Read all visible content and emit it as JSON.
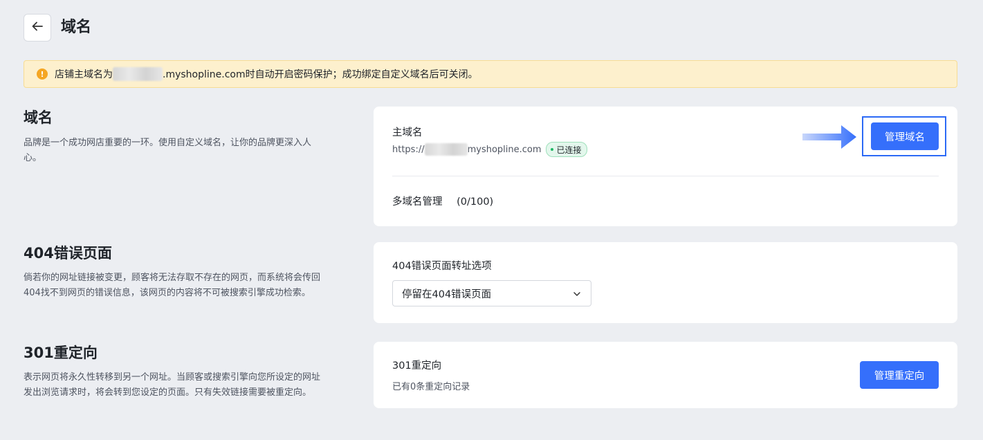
{
  "header": {
    "title": "域名"
  },
  "notice": {
    "prefix": "店铺主域名为",
    "suffix": ".myshopline.com时自动开启密码保护；成功绑定自定义域名后可关闭。"
  },
  "sections": {
    "domain": {
      "title": "域名",
      "desc": "品牌是一个成功网店重要的一环。使用自定义域名，让你的品牌更深入人心。",
      "primary_label": "主域名",
      "url_prefix": "https://",
      "url_suffix": "myshopline.com",
      "status": "已连接",
      "manage_button": "管理域名",
      "multi_label": "多域名管理",
      "multi_count": "(0/100)"
    },
    "error404": {
      "title": "404错误页面",
      "desc": "倘若你的网址链接被变更，顾客将无法存取不存在的网页，而系统将会传回404找不到网页的错误信息，该网页的内容将不可被搜索引擎成功检索。",
      "select_label": "404错误页面转址选项",
      "select_value": "停留在404错误页面"
    },
    "redirect": {
      "title": "301重定向",
      "desc": "表示网页将永久性转移到另一个网址。当顾客或搜索引擎向您所设定的网址发出浏览请求时，将会转到您设定的页面。只有失效链接需要被重定向。",
      "card_title": "301重定向",
      "record_text": "已有0条重定向记录",
      "manage_button": "管理重定向"
    }
  },
  "colors": {
    "accent": "#356ffb",
    "notice_bg": "#fdf0cd",
    "success": "#1fb865"
  },
  "icons": {
    "back": "arrow-left-icon",
    "warning": "warning-icon",
    "dropdown": "chevron-down-icon",
    "pointer": "arrow-right-icon"
  }
}
